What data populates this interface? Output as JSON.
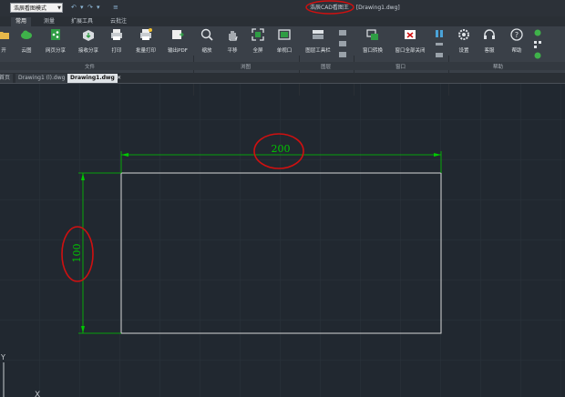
{
  "titlebar": {
    "mode": "浩辰看图模式",
    "app_title": "浩辰CAD看图王",
    "doc_name": "[Drawing1.dwg]"
  },
  "ribbon_tabs": [
    "常用",
    "测量",
    "扩展工具",
    "云批注"
  ],
  "tools": {
    "open": "开",
    "cloud": "云图",
    "web_share": "网页分享",
    "recv_share": "接收分享",
    "print": "打印",
    "batch_print": "批量打印",
    "export_pdf": "输出PDF",
    "zoom": "缩放",
    "pan": "平移",
    "fullscreen": "全屏",
    "viewport": "单视口",
    "layer_toolbar": "图层工具栏",
    "window_switch": "窗口转换",
    "close_all": "窗口全部关闭",
    "settings": "设置",
    "support": "客服",
    "help": "帮助"
  },
  "groups": [
    "文件",
    "浏图",
    "图层",
    "窗口",
    "帮助"
  ],
  "file_tabs": [
    "首页",
    "Drawing1 (l).dwg",
    "Drawing1.dwg"
  ],
  "close_glyph": "✕",
  "drawing": {
    "dim_width": "200",
    "dim_height": "100",
    "axis_y": "Y",
    "axis_x": "X"
  },
  "colors": {
    "canvas": "#212830",
    "dimension": "#00c800",
    "rectangle": "#d8d8d8",
    "annotation": "#d01010"
  }
}
